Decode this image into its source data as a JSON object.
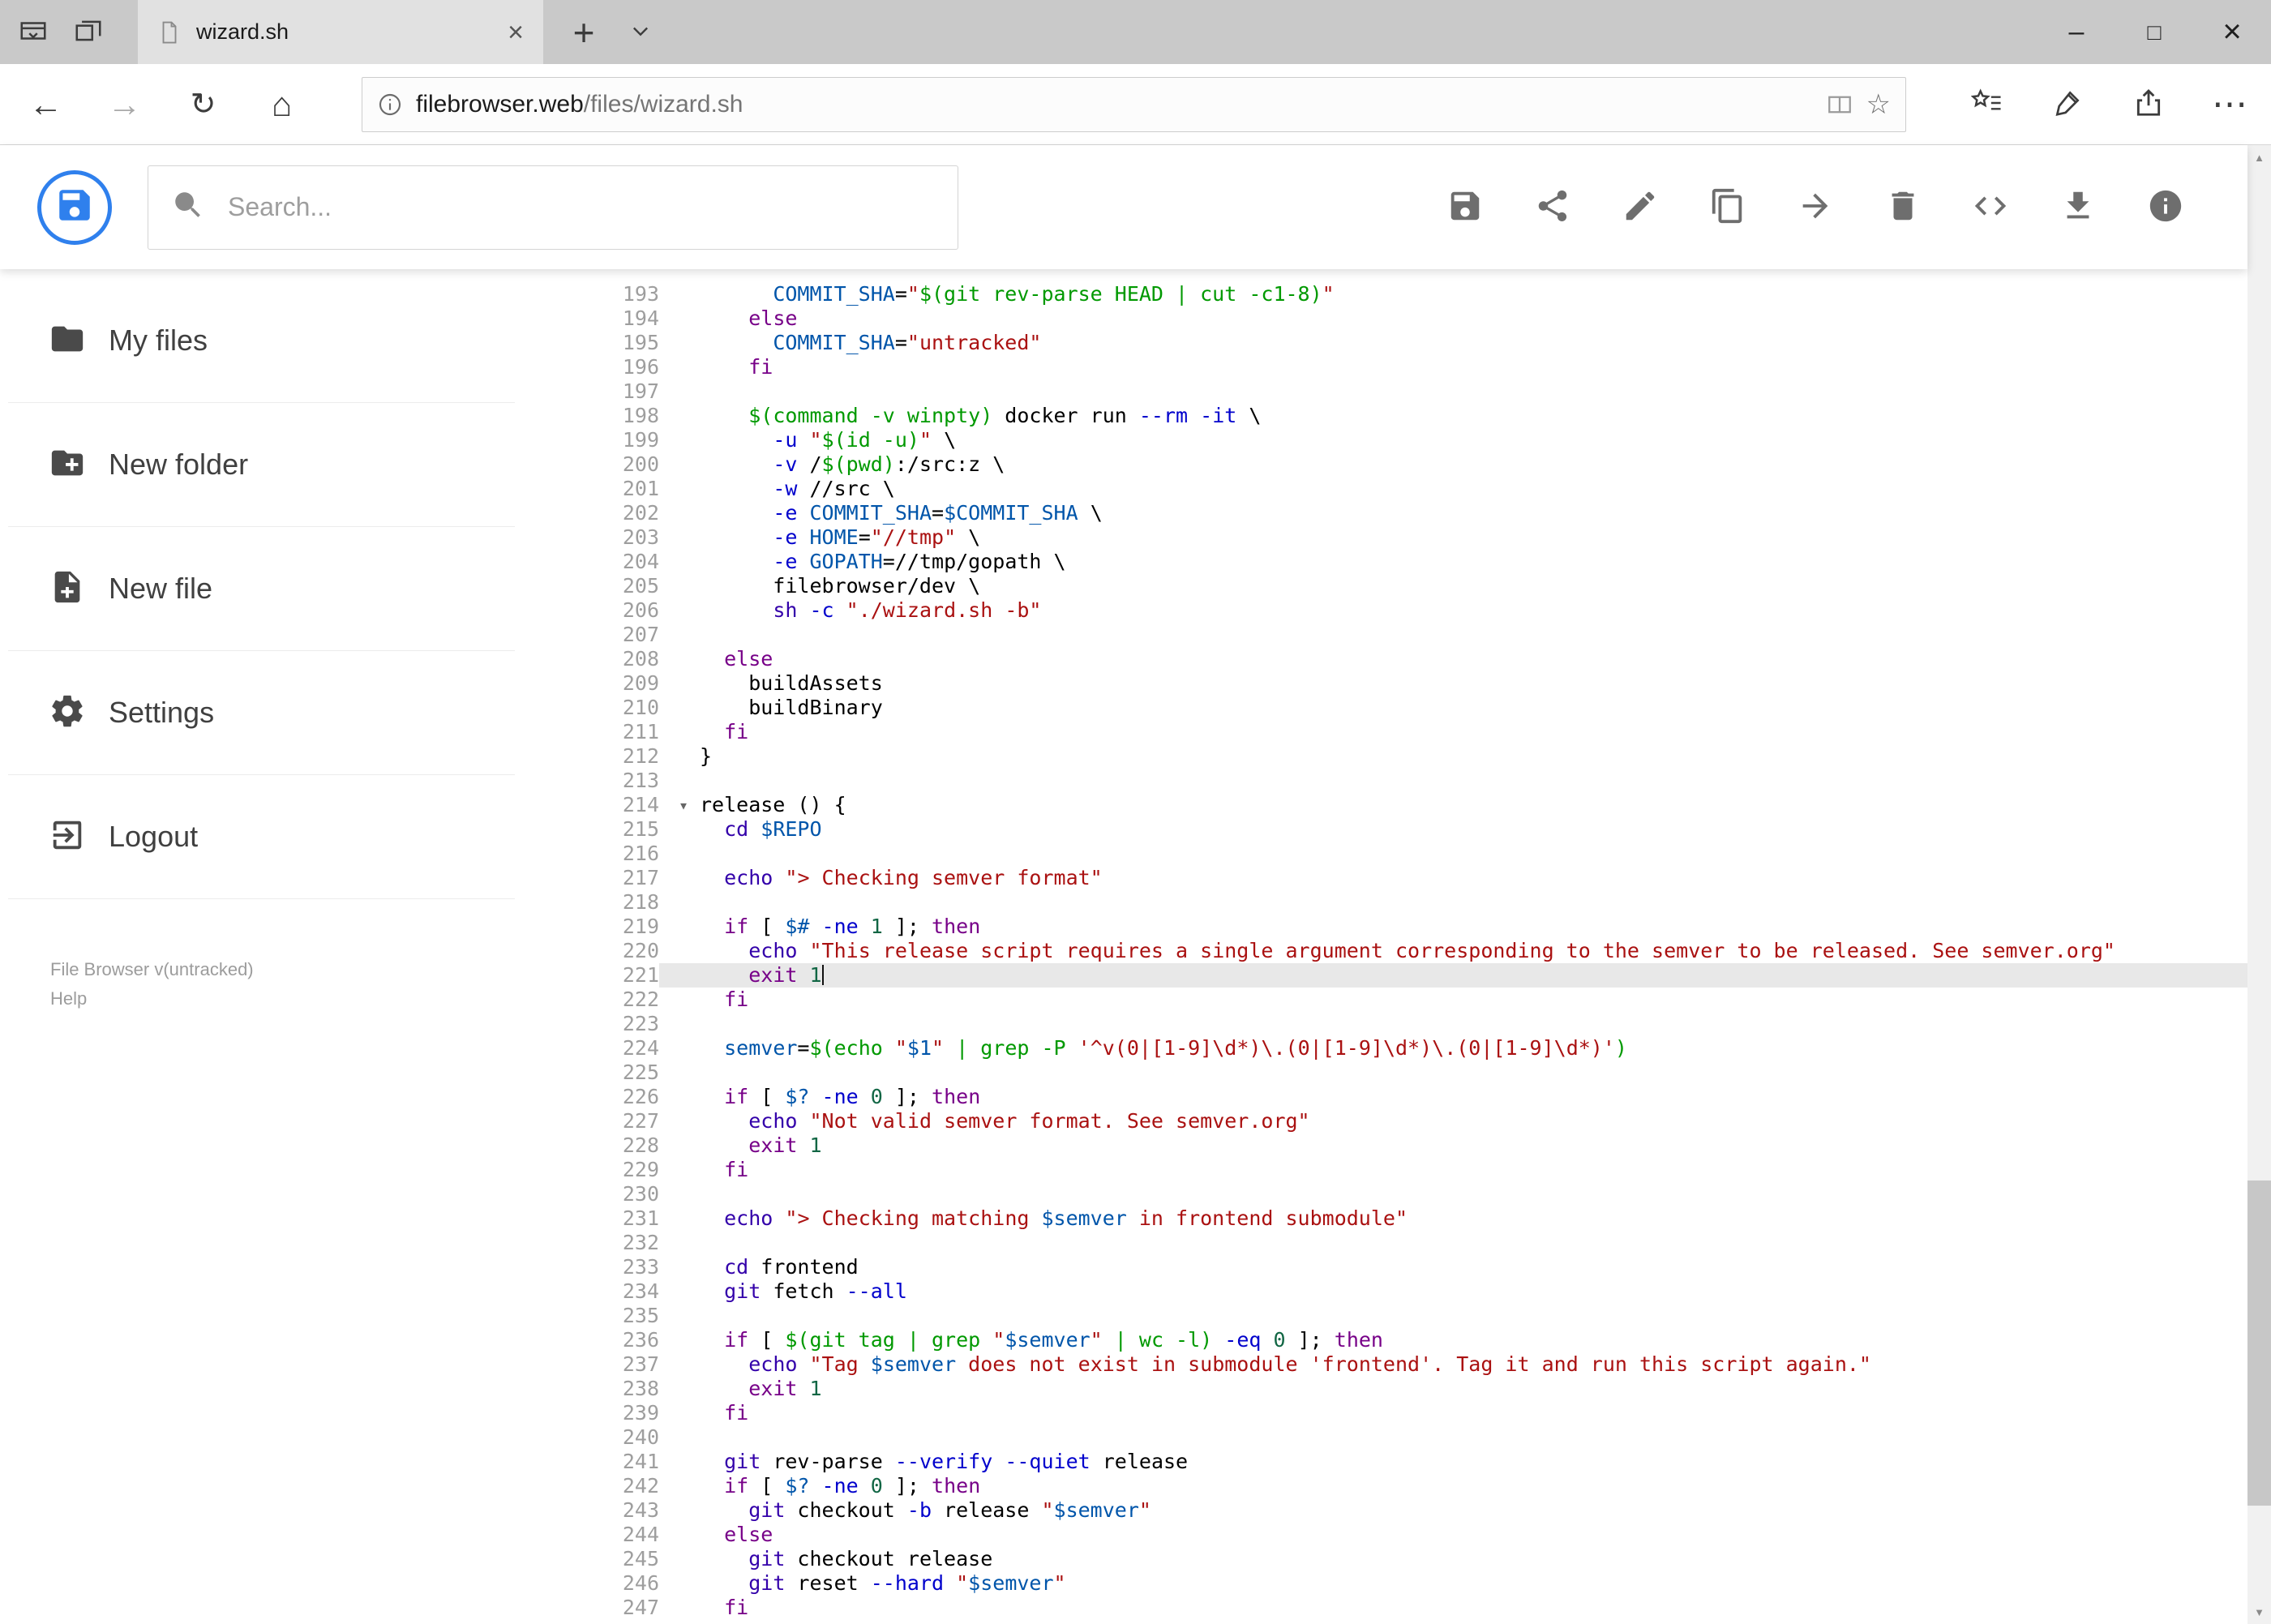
{
  "browser": {
    "tab_title": "wizard.sh",
    "url_host": "filebrowser.web",
    "url_path": "/files/wizard.sh"
  },
  "glyphs": {
    "back": "←",
    "forward": "→",
    "refresh": "↻",
    "home": "⌂",
    "star": "☆",
    "new_tab": "+",
    "minimize": "–",
    "maximize": "□",
    "close": "×",
    "tab_close": "×",
    "ellipsis": "⋯",
    "scroll_up": "▲",
    "scroll_down": "▼",
    "fold": "▾"
  },
  "header": {
    "search_placeholder": "Search...",
    "action_icons": [
      "save",
      "share",
      "edit",
      "copy",
      "move",
      "delete",
      "code",
      "download",
      "info"
    ]
  },
  "sidebar": {
    "items": [
      {
        "label": "My files"
      },
      {
        "label": "New folder"
      },
      {
        "label": "New file"
      },
      {
        "label": "Settings"
      },
      {
        "label": "Logout"
      }
    ],
    "footer_version": "File Browser v(untracked)",
    "footer_help": "Help"
  },
  "colors": {
    "accent": "#2f80ed",
    "keyword": "#708",
    "builtin": "#30a",
    "string": "#a11",
    "command_subst": "#090",
    "variable": "#05a",
    "attribute": "#00c",
    "number": "#164",
    "active_line_bg": "#e8e8e8"
  },
  "editor": {
    "first_line": 193,
    "last_line": 247,
    "active_line": 221,
    "fold_line": 214,
    "lines": [
      {
        "n": 193,
        "t": [
          [
            "p",
            "      "
          ],
          [
            "d",
            "COMMIT_SHA"
          ],
          [
            "o",
            "="
          ],
          [
            "s",
            "\""
          ],
          [
            "q",
            "$(git rev-parse HEAD | cut -c1-8)"
          ],
          [
            "s",
            "\""
          ]
        ]
      },
      {
        "n": 194,
        "t": [
          [
            "p",
            "    "
          ],
          [
            "k",
            "else"
          ]
        ]
      },
      {
        "n": 195,
        "t": [
          [
            "p",
            "      "
          ],
          [
            "d",
            "COMMIT_SHA"
          ],
          [
            "o",
            "="
          ],
          [
            "s",
            "\"untracked\""
          ]
        ]
      },
      {
        "n": 196,
        "t": [
          [
            "p",
            "    "
          ],
          [
            "k",
            "fi"
          ]
        ]
      },
      {
        "n": 197,
        "t": []
      },
      {
        "n": 198,
        "t": [
          [
            "p",
            "    "
          ],
          [
            "q",
            "$(command -v winpty)"
          ],
          [
            "p",
            " docker run "
          ],
          [
            "a",
            "--rm"
          ],
          [
            "p",
            " "
          ],
          [
            "a",
            "-it"
          ],
          [
            "p",
            " \\"
          ]
        ]
      },
      {
        "n": 199,
        "t": [
          [
            "p",
            "      "
          ],
          [
            "a",
            "-u"
          ],
          [
            "p",
            " "
          ],
          [
            "s",
            "\""
          ],
          [
            "q",
            "$(id -u)"
          ],
          [
            "s",
            "\""
          ],
          [
            "p",
            " \\"
          ]
        ]
      },
      {
        "n": 200,
        "t": [
          [
            "p",
            "      "
          ],
          [
            "a",
            "-v"
          ],
          [
            "p",
            " /"
          ],
          [
            "q",
            "$(pwd)"
          ],
          [
            "p",
            ":/src:z \\"
          ]
        ]
      },
      {
        "n": 201,
        "t": [
          [
            "p",
            "      "
          ],
          [
            "a",
            "-w"
          ],
          [
            "p",
            " //src \\"
          ]
        ]
      },
      {
        "n": 202,
        "t": [
          [
            "p",
            "      "
          ],
          [
            "a",
            "-e"
          ],
          [
            "p",
            " "
          ],
          [
            "d",
            "COMMIT_SHA"
          ],
          [
            "o",
            "="
          ],
          [
            "v",
            "$COMMIT_SHA"
          ],
          [
            "p",
            " \\"
          ]
        ]
      },
      {
        "n": 203,
        "t": [
          [
            "p",
            "      "
          ],
          [
            "a",
            "-e"
          ],
          [
            "p",
            " "
          ],
          [
            "d",
            "HOME"
          ],
          [
            "o",
            "="
          ],
          [
            "s",
            "\"//tmp\""
          ],
          [
            "p",
            " \\"
          ]
        ]
      },
      {
        "n": 204,
        "t": [
          [
            "p",
            "      "
          ],
          [
            "a",
            "-e"
          ],
          [
            "p",
            " "
          ],
          [
            "d",
            "GOPATH"
          ],
          [
            "o",
            "="
          ],
          [
            "p",
            "//tmp/gopath \\"
          ]
        ]
      },
      {
        "n": 205,
        "t": [
          [
            "p",
            "      filebrowser/dev \\"
          ]
        ]
      },
      {
        "n": 206,
        "t": [
          [
            "p",
            "      "
          ],
          [
            "b",
            "sh"
          ],
          [
            "p",
            " "
          ],
          [
            "a",
            "-c"
          ],
          [
            "p",
            " "
          ],
          [
            "s",
            "\"./wizard.sh -b\""
          ]
        ]
      },
      {
        "n": 207,
        "t": []
      },
      {
        "n": 208,
        "t": [
          [
            "p",
            "  "
          ],
          [
            "k",
            "else"
          ]
        ]
      },
      {
        "n": 209,
        "t": [
          [
            "p",
            "    buildAssets"
          ]
        ]
      },
      {
        "n": 210,
        "t": [
          [
            "p",
            "    buildBinary"
          ]
        ]
      },
      {
        "n": 211,
        "t": [
          [
            "p",
            "  "
          ],
          [
            "k",
            "fi"
          ]
        ]
      },
      {
        "n": 212,
        "t": [
          [
            "p",
            "}"
          ]
        ]
      },
      {
        "n": 213,
        "t": []
      },
      {
        "n": 214,
        "t": [
          [
            "p",
            "release () {"
          ]
        ]
      },
      {
        "n": 215,
        "t": [
          [
            "p",
            "  "
          ],
          [
            "b",
            "cd"
          ],
          [
            "p",
            " "
          ],
          [
            "v",
            "$REPO"
          ]
        ]
      },
      {
        "n": 216,
        "t": []
      },
      {
        "n": 217,
        "t": [
          [
            "p",
            "  "
          ],
          [
            "b",
            "echo"
          ],
          [
            "p",
            " "
          ],
          [
            "s",
            "\"> Checking semver format\""
          ]
        ]
      },
      {
        "n": 218,
        "t": []
      },
      {
        "n": 219,
        "t": [
          [
            "p",
            "  "
          ],
          [
            "k",
            "if"
          ],
          [
            "p",
            " [ "
          ],
          [
            "v",
            "$#"
          ],
          [
            "p",
            " "
          ],
          [
            "a",
            "-ne"
          ],
          [
            "p",
            " "
          ],
          [
            "n",
            "1"
          ],
          [
            "p",
            " ]; "
          ],
          [
            "k",
            "then"
          ]
        ]
      },
      {
        "n": 220,
        "t": [
          [
            "p",
            "    "
          ],
          [
            "b",
            "echo"
          ],
          [
            "p",
            " "
          ],
          [
            "s",
            "\"This release script requires a single argument corresponding to the semver to be released. See semver.org\""
          ]
        ]
      },
      {
        "n": 221,
        "t": [
          [
            "p",
            "    "
          ],
          [
            "k",
            "exit"
          ],
          [
            "p",
            " "
          ],
          [
            "n",
            "1"
          ],
          [
            "c",
            ""
          ]
        ]
      },
      {
        "n": 222,
        "t": [
          [
            "p",
            "  "
          ],
          [
            "k",
            "fi"
          ]
        ]
      },
      {
        "n": 223,
        "t": []
      },
      {
        "n": 224,
        "t": [
          [
            "p",
            "  "
          ],
          [
            "d",
            "semver"
          ],
          [
            "o",
            "="
          ],
          [
            "q",
            "$(echo "
          ],
          [
            "s",
            "\""
          ],
          [
            "v",
            "$1"
          ],
          [
            "s",
            "\""
          ],
          [
            "q",
            " | grep -P "
          ],
          [
            "s",
            "'^v(0|[1-9]\\d*)\\.(0|[1-9]\\d*)\\.(0|[1-9]\\d*)'"
          ],
          [
            "q",
            ")"
          ]
        ]
      },
      {
        "n": 225,
        "t": []
      },
      {
        "n": 226,
        "t": [
          [
            "p",
            "  "
          ],
          [
            "k",
            "if"
          ],
          [
            "p",
            " [ "
          ],
          [
            "v",
            "$?"
          ],
          [
            "p",
            " "
          ],
          [
            "a",
            "-ne"
          ],
          [
            "p",
            " "
          ],
          [
            "n",
            "0"
          ],
          [
            "p",
            " ]; "
          ],
          [
            "k",
            "then"
          ]
        ]
      },
      {
        "n": 227,
        "t": [
          [
            "p",
            "    "
          ],
          [
            "b",
            "echo"
          ],
          [
            "p",
            " "
          ],
          [
            "s",
            "\"Not valid semver format. See semver.org\""
          ]
        ]
      },
      {
        "n": 228,
        "t": [
          [
            "p",
            "    "
          ],
          [
            "k",
            "exit"
          ],
          [
            "p",
            " "
          ],
          [
            "n",
            "1"
          ]
        ]
      },
      {
        "n": 229,
        "t": [
          [
            "p",
            "  "
          ],
          [
            "k",
            "fi"
          ]
        ]
      },
      {
        "n": 230,
        "t": []
      },
      {
        "n": 231,
        "t": [
          [
            "p",
            "  "
          ],
          [
            "b",
            "echo"
          ],
          [
            "p",
            " "
          ],
          [
            "s",
            "\"> Checking matching "
          ],
          [
            "v",
            "$semver"
          ],
          [
            "s",
            " in frontend submodule\""
          ]
        ]
      },
      {
        "n": 232,
        "t": []
      },
      {
        "n": 233,
        "t": [
          [
            "p",
            "  "
          ],
          [
            "b",
            "cd"
          ],
          [
            "p",
            " frontend"
          ]
        ]
      },
      {
        "n": 234,
        "t": [
          [
            "p",
            "  "
          ],
          [
            "b",
            "git"
          ],
          [
            "p",
            " fetch "
          ],
          [
            "a",
            "--all"
          ]
        ]
      },
      {
        "n": 235,
        "t": []
      },
      {
        "n": 236,
        "t": [
          [
            "p",
            "  "
          ],
          [
            "k",
            "if"
          ],
          [
            "p",
            " [ "
          ],
          [
            "q",
            "$(git tag | grep "
          ],
          [
            "s",
            "\""
          ],
          [
            "v",
            "$semver"
          ],
          [
            "s",
            "\""
          ],
          [
            "q",
            " | wc -l)"
          ],
          [
            "p",
            " "
          ],
          [
            "a",
            "-eq"
          ],
          [
            "p",
            " "
          ],
          [
            "n",
            "0"
          ],
          [
            "p",
            " ]; "
          ],
          [
            "k",
            "then"
          ]
        ]
      },
      {
        "n": 237,
        "t": [
          [
            "p",
            "    "
          ],
          [
            "b",
            "echo"
          ],
          [
            "p",
            " "
          ],
          [
            "s",
            "\"Tag "
          ],
          [
            "v",
            "$semver"
          ],
          [
            "s",
            " does not exist in submodule 'frontend'. Tag it and run this script again.\""
          ]
        ]
      },
      {
        "n": 238,
        "t": [
          [
            "p",
            "    "
          ],
          [
            "k",
            "exit"
          ],
          [
            "p",
            " "
          ],
          [
            "n",
            "1"
          ]
        ]
      },
      {
        "n": 239,
        "t": [
          [
            "p",
            "  "
          ],
          [
            "k",
            "fi"
          ]
        ]
      },
      {
        "n": 240,
        "t": []
      },
      {
        "n": 241,
        "t": [
          [
            "p",
            "  "
          ],
          [
            "b",
            "git"
          ],
          [
            "p",
            " rev-parse "
          ],
          [
            "a",
            "--verify"
          ],
          [
            "p",
            " "
          ],
          [
            "a",
            "--quiet"
          ],
          [
            "p",
            " release"
          ]
        ]
      },
      {
        "n": 242,
        "t": [
          [
            "p",
            "  "
          ],
          [
            "k",
            "if"
          ],
          [
            "p",
            " [ "
          ],
          [
            "v",
            "$?"
          ],
          [
            "p",
            " "
          ],
          [
            "a",
            "-ne"
          ],
          [
            "p",
            " "
          ],
          [
            "n",
            "0"
          ],
          [
            "p",
            " ]; "
          ],
          [
            "k",
            "then"
          ]
        ]
      },
      {
        "n": 243,
        "t": [
          [
            "p",
            "    "
          ],
          [
            "b",
            "git"
          ],
          [
            "p",
            " checkout "
          ],
          [
            "a",
            "-b"
          ],
          [
            "p",
            " release "
          ],
          [
            "s",
            "\""
          ],
          [
            "v",
            "$semver"
          ],
          [
            "s",
            "\""
          ]
        ]
      },
      {
        "n": 244,
        "t": [
          [
            "p",
            "  "
          ],
          [
            "k",
            "else"
          ]
        ]
      },
      {
        "n": 245,
        "t": [
          [
            "p",
            "    "
          ],
          [
            "b",
            "git"
          ],
          [
            "p",
            " checkout release"
          ]
        ]
      },
      {
        "n": 246,
        "t": [
          [
            "p",
            "    "
          ],
          [
            "b",
            "git"
          ],
          [
            "p",
            " reset "
          ],
          [
            "a",
            "--hard"
          ],
          [
            "p",
            " "
          ],
          [
            "s",
            "\""
          ],
          [
            "v",
            "$semver"
          ],
          [
            "s",
            "\""
          ]
        ]
      },
      {
        "n": 247,
        "t": [
          [
            "p",
            "  "
          ],
          [
            "k",
            "fi"
          ]
        ]
      }
    ]
  }
}
